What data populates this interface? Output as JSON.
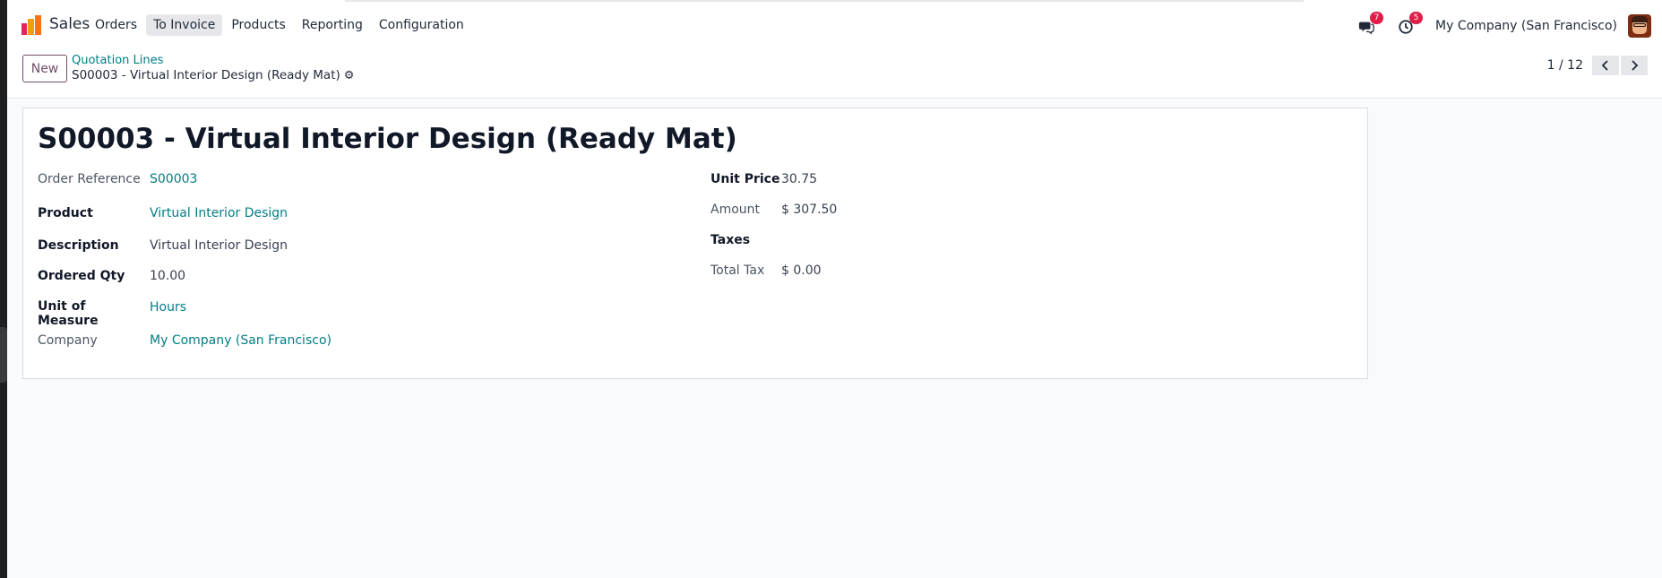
{
  "navbar": {
    "app_name": "Sales",
    "menu": [
      "Orders",
      "To Invoice",
      "Products",
      "Reporting",
      "Configuration"
    ],
    "active_menu": "To Invoice",
    "messages_count": "7",
    "activities_count": "5",
    "company": "My Company (San Francisco)",
    "icons": [
      "sales-logo-icon",
      "chat-icon",
      "clock-icon",
      "user-avatar"
    ]
  },
  "control_panel": {
    "new_label": "New",
    "breadcrumb_parent": "Quotation Lines",
    "breadcrumb_current": "S00003 - Virtual Interior Design (Ready Mat)",
    "pager": "1 / 12"
  },
  "form": {
    "title": "S00003 - Virtual Interior Design (Ready Mat)",
    "left": [
      {
        "label": "Order Reference",
        "value": "S00003"
      },
      {
        "label": "Product",
        "value": "Virtual Interior Design"
      },
      {
        "label": "Description",
        "value": "Virtual Interior Design"
      },
      {
        "label": "Ordered Qty",
        "value": "10.00"
      },
      {
        "label": "Unit of Measure",
        "value": "Hours"
      },
      {
        "label": "Company",
        "value": "My Company (San Francisco)"
      }
    ],
    "right": [
      {
        "label": "Unit Price",
        "value": "30.75"
      },
      {
        "label": "Amount",
        "value": "$ 307.50"
      },
      {
        "label": "Taxes",
        "value": ""
      },
      {
        "label": "Total Tax",
        "value": "$ 0.00"
      }
    ]
  },
  "colors": {
    "link": "#017e84",
    "brand": "#714b67",
    "badge": "#e11d48"
  }
}
